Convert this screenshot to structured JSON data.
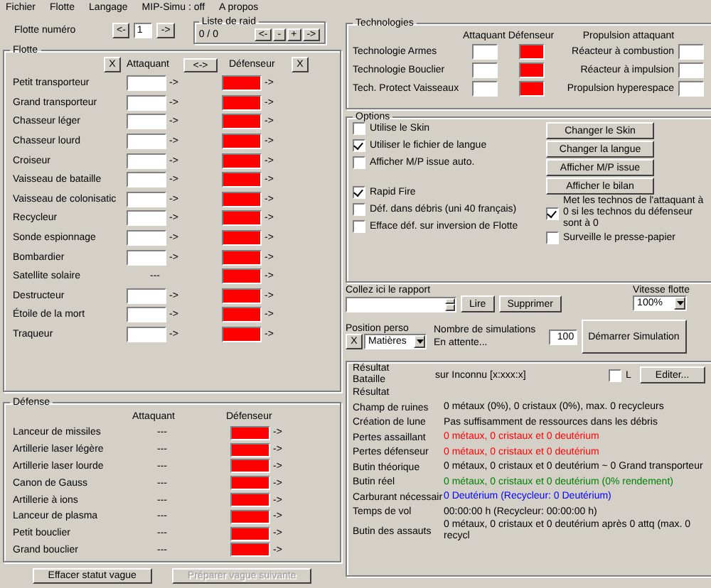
{
  "menu": [
    "Fichier",
    "Flotte",
    "Langage",
    "MIP-Simu : off",
    "A propos"
  ],
  "fleet_selector": {
    "label": "Flotte numéro",
    "prev": "<-",
    "value": "1",
    "next": "->"
  },
  "raid_list": {
    "title": "Liste de raid",
    "count": "0 / 0",
    "buttons": [
      "<-",
      "-",
      "+",
      "->"
    ]
  },
  "fleet": {
    "title": "Flotte",
    "clear_attacker": "X",
    "attacker_header": "Attaquant",
    "swap": "<->",
    "defender_header": "Défenseur",
    "clear_defender": "X",
    "rows": [
      {
        "name": "Petit transporteur",
        "kind": "input",
        "attacker_arrow": "->",
        "defender_arrow": "->"
      },
      {
        "name": "Grand transporteur",
        "kind": "input",
        "attacker_arrow": "->",
        "defender_arrow": "->"
      },
      {
        "name": "Chasseur léger",
        "kind": "input",
        "attacker_arrow": "->",
        "defender_arrow": "->"
      },
      {
        "name": "Chasseur lourd",
        "kind": "input",
        "attacker_arrow": "->",
        "defender_arrow": "->"
      },
      {
        "name": "Croiseur",
        "kind": "input",
        "attacker_arrow": "->",
        "defender_arrow": "->"
      },
      {
        "name": "Vaisseau de bataille",
        "kind": "input",
        "attacker_arrow": "->",
        "defender_arrow": "->"
      },
      {
        "name": "Vaisseau de colonisatic",
        "kind": "input",
        "attacker_arrow": "->",
        "defender_arrow": "->"
      },
      {
        "name": "Recycleur",
        "kind": "input",
        "attacker_arrow": "->",
        "defender_arrow": "->"
      },
      {
        "name": "Sonde espionnage",
        "kind": "input",
        "attacker_arrow": "->",
        "defender_arrow": "->"
      },
      {
        "name": "Bombardier",
        "kind": "input",
        "attacker_arrow": "->",
        "defender_arrow": "->"
      },
      {
        "name": "Satellite solaire",
        "kind": "fixed",
        "attacker_text": "---",
        "defender_arrow": "->"
      },
      {
        "name": "Destructeur",
        "kind": "input",
        "attacker_arrow": "->",
        "defender_arrow": "->"
      },
      {
        "name": "Étoile de la mort",
        "kind": "input",
        "attacker_arrow": "->",
        "defender_arrow": "->"
      },
      {
        "name": "Traqueur",
        "kind": "input",
        "attacker_arrow": "->",
        "defender_arrow": "->"
      }
    ]
  },
  "defense": {
    "title": "Défense",
    "attacker_header": "Attaquant",
    "defender_header": "Défenseur",
    "rows": [
      {
        "name": "Lanceur de missiles",
        "kind": "fixed",
        "attacker_text": "---",
        "defender_arrow": "->"
      },
      {
        "name": "Artillerie laser légère",
        "kind": "fixed",
        "attacker_text": "---",
        "defender_arrow": "->"
      },
      {
        "name": "Artillerie laser lourde",
        "kind": "fixed",
        "attacker_text": "---",
        "defender_arrow": "->"
      },
      {
        "name": "Canon de Gauss",
        "kind": "fixed",
        "attacker_text": "---",
        "defender_arrow": "->"
      },
      {
        "name": "Artillerie à ions",
        "kind": "fixed",
        "attacker_text": "---",
        "defender_arrow": "->"
      },
      {
        "name": "Lanceur de plasma",
        "kind": "fixed",
        "attacker_text": "---",
        "defender_arrow": "->"
      },
      {
        "name": "Petit bouclier",
        "kind": "fixed",
        "attacker_text": "---",
        "defender_arrow": "->"
      },
      {
        "name": "Grand bouclier",
        "kind": "fixed",
        "attacker_text": "---",
        "defender_arrow": "->"
      }
    ]
  },
  "wave_buttons": [
    {
      "label": "Effacer statut vague",
      "disabled": false
    },
    {
      "label": "Préparer vague suivante",
      "disabled": true
    }
  ],
  "technologies": {
    "title": "Technologies",
    "attacker_header": "Attaquant",
    "defender_header": "Défenseur",
    "drive_header": "Propulsion attaquant",
    "rows": [
      {
        "name": "Technologie Armes",
        "drive": "Réacteur à combustion"
      },
      {
        "name": "Technologie Bouclier",
        "drive": "Réacteur à impulsion"
      },
      {
        "name": "Tech. Protect Vaisseaux",
        "drive": "Propulsion hyperespace"
      }
    ]
  },
  "options": {
    "title": "Options",
    "checks_top": [
      {
        "label": "Utilise le Skin",
        "checked": false
      },
      {
        "label": "Utiliser le fichier de langue",
        "checked": true
      },
      {
        "label": "Afficher M/P issue auto.",
        "checked": false
      }
    ],
    "checks_bottom": [
      {
        "label": "Rapid Fire",
        "checked": true
      },
      {
        "label": "Déf. dans débris (uni 40 français)",
        "checked": false
      },
      {
        "label": "Efface déf. sur inversion de Flotte",
        "checked": false
      }
    ],
    "buttons": [
      "Changer le Skin",
      "Changer la langue",
      "Afficher M/P issue",
      "Afficher le bilan"
    ],
    "checks_right": [
      {
        "label": "Met les technos de l'attaquant à 0 si les technos du défenseur sont à 0",
        "checked": true
      },
      {
        "label": "Surveille le presse-papier",
        "checked": false
      }
    ]
  },
  "report": {
    "label": "Collez ici le rapport",
    "read_button": "Lire",
    "delete_button": "Supprimer",
    "speed_label": "Vitesse flotte",
    "speed": "100%"
  },
  "position": {
    "label": "Position perso",
    "clear": "X",
    "resource": "Matières",
    "simulations_label": "Nombre de simulations",
    "simulations": "100",
    "status": "En attente...",
    "start_button": "Démarrer Simulation"
  },
  "result": {
    "title": "Résultat",
    "battle_label": "Bataille",
    "battle_value": "sur Inconnu [x:xxx:x]",
    "l_label": "L",
    "l_checked": false,
    "edit_button": "Editer...",
    "subtitle": "Résultat",
    "lines": [
      {
        "label": "Champ de ruines",
        "value": "0 métaux (0%), 0 cristaux (0%), max. 0 recycleurs",
        "color": "#000000"
      },
      {
        "label": "Création de lune",
        "value": "Pas suffisamment de ressources dans les débris",
        "color": "#000000"
      },
      {
        "label": "Pertes assaillant",
        "value": "0 métaux, 0 cristaux et 0 deutérium",
        "color": "#ff0000"
      },
      {
        "label": "Pertes défenseur",
        "value": "0 métaux, 0 cristaux et 0 deutérium",
        "color": "#ff0000"
      },
      {
        "label": "Butin théorique",
        "value": "0 métaux, 0 cristaux et 0 deutérium ~ 0 Grand transporteur",
        "color": "#000000"
      },
      {
        "label": "Butin réel",
        "value": "0 métaux, 0 cristaux et 0 deutérium (0% rendement)",
        "color": "#008000"
      },
      {
        "label": "Carburant nécessair",
        "value": "0 Deutérium (Recycleur: 0 Deutérium)",
        "color": "#0000ff"
      },
      {
        "label": "Temps de vol",
        "value": "00:00:00 h (Recycleur: 00:00:00 h)",
        "color": "#000000"
      },
      {
        "label": "Butin des assauts",
        "value": "0 métaux, 0 cristaux et 0 deutérium après 0 attq (max. 0 recycl",
        "color": "#000000"
      }
    ]
  }
}
